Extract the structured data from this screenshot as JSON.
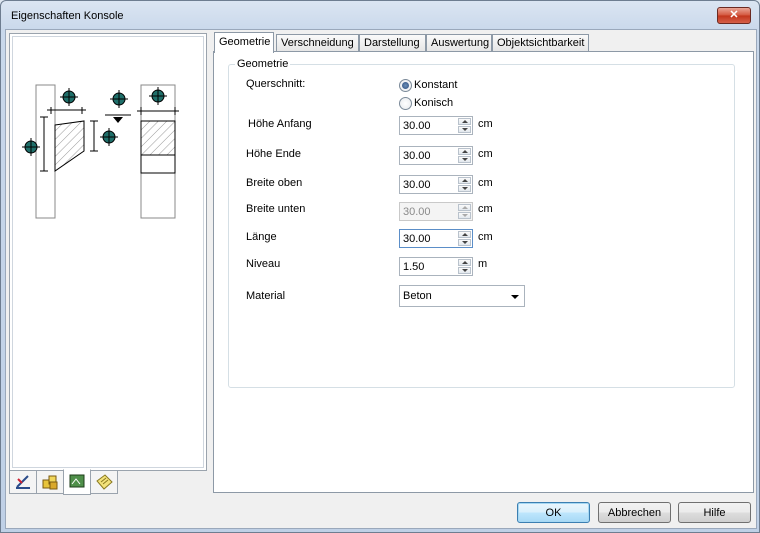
{
  "window": {
    "title": "Eigenschaften Konsole",
    "close_glyph": "✕"
  },
  "left_tabs": [
    {
      "icon": "drawing-ruler-icon"
    },
    {
      "icon": "materials-icon"
    },
    {
      "icon": "layer-properties-icon"
    },
    {
      "icon": "note-icon"
    }
  ],
  "tabs": [
    {
      "label": "Geometrie"
    },
    {
      "label": "Verschneidung"
    },
    {
      "label": "Darstellung"
    },
    {
      "label": "Auswertung"
    },
    {
      "label": "Objektsichtbarkeit"
    }
  ],
  "group": {
    "label": "Geometrie"
  },
  "querschnitt": {
    "label": "Querschnitt:",
    "options": [
      {
        "label": "Konstant",
        "checked": true
      },
      {
        "label": "Konisch",
        "checked": false
      }
    ]
  },
  "fields": [
    {
      "label": "Höhe Anfang",
      "value": "30.00",
      "unit": "cm",
      "enabled": true
    },
    {
      "label": "Höhe Ende",
      "value": "30.00",
      "unit": "cm",
      "enabled": true
    },
    {
      "label": "Breite oben",
      "value": "30.00",
      "unit": "cm",
      "enabled": true
    },
    {
      "label": "Breite unten",
      "value": "30.00",
      "unit": "cm",
      "enabled": false
    },
    {
      "label": "Länge",
      "value": "30.00",
      "unit": "cm",
      "enabled": true
    },
    {
      "label": "Niveau",
      "value": "1.50",
      "unit": "m",
      "enabled": true
    }
  ],
  "material": {
    "label": "Material",
    "value": "Beton"
  },
  "buttons": {
    "ok": "OK",
    "cancel": "Abbrechen",
    "help": "Hilfe"
  },
  "colors": {
    "handle": "#1f6f6a",
    "accent": "#3c7fb1"
  }
}
